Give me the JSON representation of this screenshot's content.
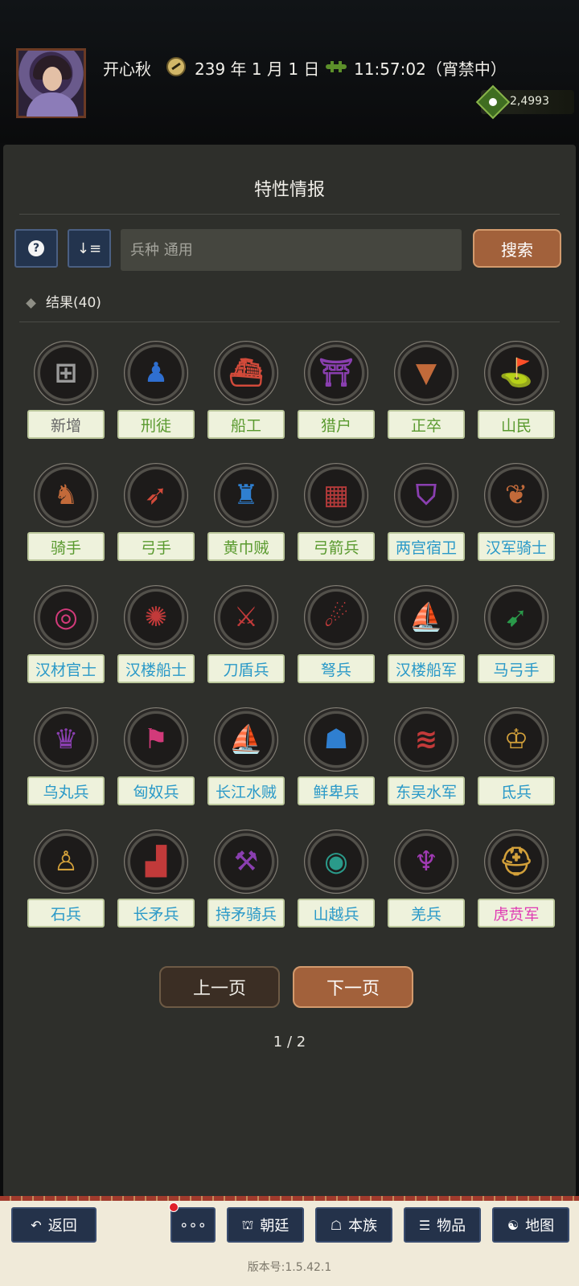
{
  "header": {
    "player_name": "开心秋",
    "date": "239 年 1 月 1 日",
    "time": "11:57:02（宵禁中）",
    "currency": "2,4993"
  },
  "panel": {
    "title": "特性情报",
    "search_placeholder": "兵种 通用",
    "search_label": "搜索",
    "help_label": "?",
    "sort_label": "↓≡",
    "results_label": "结果(40)"
  },
  "traits": [
    {
      "name": "新增",
      "color": "gray",
      "icon": "add-frame-icon",
      "glyph": "⊞",
      "glyph_color": "#9a9a9a"
    },
    {
      "name": "刑徒",
      "color": "green",
      "icon": "prisoner-icon",
      "glyph": "♟",
      "glyph_color": "#2f6fd0"
    },
    {
      "name": "船工",
      "color": "green",
      "icon": "ship-worker-icon",
      "glyph": "⛴",
      "glyph_color": "#d24a3a"
    },
    {
      "name": "猎户",
      "color": "green",
      "icon": "hunter-icon",
      "glyph": "⛩",
      "glyph_color": "#8a3fb0"
    },
    {
      "name": "正卒",
      "color": "green",
      "icon": "regular-soldier-icon",
      "glyph": "▼",
      "glyph_color": "#c26a3a"
    },
    {
      "name": "山民",
      "color": "green",
      "icon": "mountain-flag-icon",
      "glyph": "⛳",
      "glyph_color": "#2f6fd0"
    },
    {
      "name": "骑手",
      "color": "green",
      "icon": "horse-rider-icon",
      "glyph": "♞",
      "glyph_color": "#c26a3a"
    },
    {
      "name": "弓手",
      "color": "green",
      "icon": "archer-icon",
      "glyph": "➶",
      "glyph_color": "#d24a3a"
    },
    {
      "name": "黄巾贼",
      "color": "green",
      "icon": "yellow-turban-icon",
      "glyph": "♜",
      "glyph_color": "#2f7fd0"
    },
    {
      "name": "弓箭兵",
      "color": "green",
      "icon": "brick-wall-icon",
      "glyph": "▦",
      "glyph_color": "#b33a3a"
    },
    {
      "name": "两宫宿卫",
      "color": "blue",
      "icon": "twin-shield-icon",
      "glyph": "⛉",
      "glyph_color": "#8a3fb0"
    },
    {
      "name": "汉军骑士",
      "color": "blue",
      "icon": "antler-icon",
      "glyph": "❦",
      "glyph_color": "#c26a3a"
    },
    {
      "name": "汉材官士",
      "color": "blue",
      "icon": "target-icon",
      "glyph": "◎",
      "glyph_color": "#d23a7a"
    },
    {
      "name": "汉楼船士",
      "color": "blue",
      "icon": "swirl-icon",
      "glyph": "✺",
      "glyph_color": "#c23a3a"
    },
    {
      "name": "刀盾兵",
      "color": "blue",
      "icon": "armor-icon",
      "glyph": "⚔",
      "glyph_color": "#c23a3a"
    },
    {
      "name": "弩兵",
      "color": "blue",
      "icon": "boulder-icon",
      "glyph": "☄",
      "glyph_color": "#c23a3a"
    },
    {
      "name": "汉楼船军",
      "color": "blue",
      "icon": "warship-icon",
      "glyph": "⛵",
      "glyph_color": "#c26a3a"
    },
    {
      "name": "马弓手",
      "color": "blue",
      "icon": "arrowhead-icon",
      "glyph": "➹",
      "glyph_color": "#2a9a4a"
    },
    {
      "name": "乌丸兵",
      "color": "blue",
      "icon": "horned-helmet-icon",
      "glyph": "♛",
      "glyph_color": "#8a3fb0"
    },
    {
      "name": "匈奴兵",
      "color": "blue",
      "icon": "spear-shield-icon",
      "glyph": "⚑",
      "glyph_color": "#d23a7a"
    },
    {
      "name": "长江水贼",
      "color": "blue",
      "icon": "sailboat-icon",
      "glyph": "⛵",
      "glyph_color": "#c23a3a"
    },
    {
      "name": "鲜卑兵",
      "color": "blue",
      "icon": "mask-icon",
      "glyph": "☗",
      "glyph_color": "#2f7fd0"
    },
    {
      "name": "东吴水军",
      "color": "blue",
      "icon": "wave-icon",
      "glyph": "≋",
      "glyph_color": "#c23a3a"
    },
    {
      "name": "氐兵",
      "color": "blue",
      "icon": "totem-icon",
      "glyph": "♔",
      "glyph_color": "#d2a03a"
    },
    {
      "name": "石兵",
      "color": "blue",
      "icon": "statue-icon",
      "glyph": "♙",
      "glyph_color": "#d2a03a"
    },
    {
      "name": "长矛兵",
      "color": "blue",
      "icon": "rubble-icon",
      "glyph": "▟",
      "glyph_color": "#c23a3a"
    },
    {
      "name": "持矛骑兵",
      "color": "blue",
      "icon": "battle-axe-icon",
      "glyph": "⚒",
      "glyph_color": "#8a3fb0"
    },
    {
      "name": "山越兵",
      "color": "blue",
      "icon": "tribal-mask-icon",
      "glyph": "◉",
      "glyph_color": "#2a9a8a"
    },
    {
      "name": "羌兵",
      "color": "blue",
      "icon": "demon-mask-icon",
      "glyph": "♆",
      "glyph_color": "#a03ab3"
    },
    {
      "name": "虎贲军",
      "color": "pink",
      "icon": "golden-helmet-icon",
      "glyph": "⛑",
      "glyph_color": "#d2a03a"
    }
  ],
  "pagination": {
    "prev_label": "上一页",
    "next_label": "下一页",
    "page_indicator": "1 / 2"
  },
  "bottom_nav": {
    "back_label": "返回",
    "more_label": "∘∘∘",
    "court_label": "朝廷",
    "clan_label": "本族",
    "items_label": "物品",
    "map_label": "地图"
  },
  "version": "版本号:1.5.42.1"
}
